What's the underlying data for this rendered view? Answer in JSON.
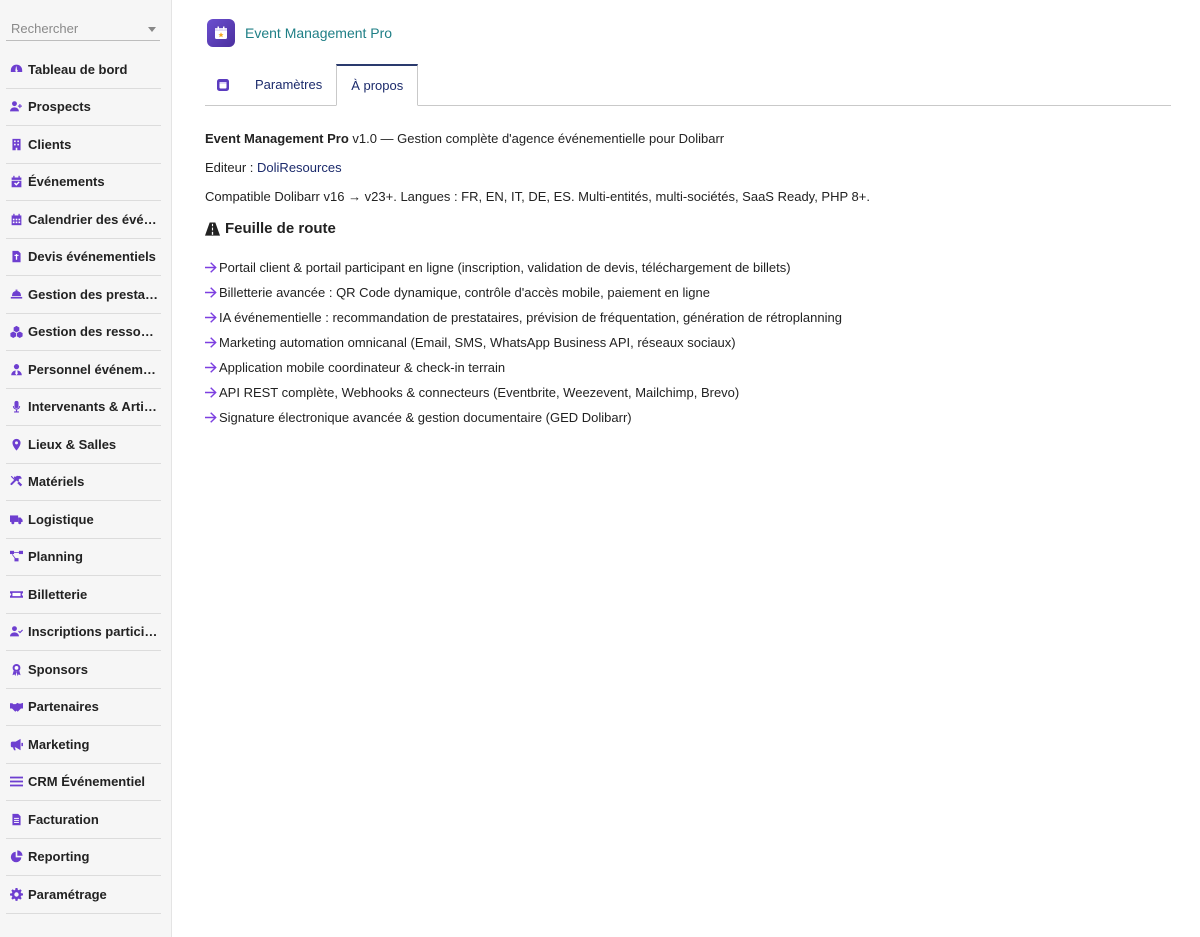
{
  "sidebar": {
    "search_placeholder": "Rechercher",
    "items": [
      {
        "label": "Tableau de bord",
        "icon": "gauge-icon"
      },
      {
        "label": "Prospects",
        "icon": "user-plus-icon"
      },
      {
        "label": "Clients",
        "icon": "building-icon"
      },
      {
        "label": "Événements",
        "icon": "calendar-check-icon"
      },
      {
        "label": "Calendrier des événements",
        "icon": "calendar-grid-icon"
      },
      {
        "label": "Devis événementiels",
        "icon": "file-invoice-icon"
      },
      {
        "label": "Gestion des prestataires",
        "icon": "concierge-bell-icon"
      },
      {
        "label": "Gestion des ressources",
        "icon": "cubes-icon"
      },
      {
        "label": "Personnel événementiel",
        "icon": "user-tie-icon"
      },
      {
        "label": "Intervenants & Artistes",
        "icon": "microphone-icon"
      },
      {
        "label": "Lieux & Salles",
        "icon": "map-marker-icon"
      },
      {
        "label": "Matériels",
        "icon": "tools-icon"
      },
      {
        "label": "Logistique",
        "icon": "truck-icon"
      },
      {
        "label": "Planning",
        "icon": "project-diagram-icon"
      },
      {
        "label": "Billetterie",
        "icon": "ticket-icon"
      },
      {
        "label": "Inscriptions participants",
        "icon": "user-check-icon"
      },
      {
        "label": "Sponsors",
        "icon": "award-icon"
      },
      {
        "label": "Partenaires",
        "icon": "handshake-icon"
      },
      {
        "label": "Marketing",
        "icon": "bullhorn-icon"
      },
      {
        "label": "CRM Événementiel",
        "icon": "bars-icon"
      },
      {
        "label": "Facturation",
        "icon": "file-text-icon"
      },
      {
        "label": "Reporting",
        "icon": "chart-pie-icon"
      },
      {
        "label": "Paramétrage",
        "icon": "gear-icon"
      }
    ]
  },
  "header": {
    "title": "Event Management Pro",
    "logo_icon": "calendar-star-icon"
  },
  "tabs": [
    {
      "label": "Paramètres",
      "active": false
    },
    {
      "label": "À propos",
      "active": true
    }
  ],
  "about": {
    "product_name": "Event Management Pro",
    "version_desc": " v1.0 — Gestion complète d'agence événementielle pour Dolibarr",
    "editor_label": "Editeur : ",
    "editor_link": "DoliResources",
    "compat": "Compatible Dolibarr v16 → v23+. Langues : FR, EN, IT, DE, ES. Multi-entités, multi-sociétés, SaaS Ready, PHP 8+."
  },
  "roadmap": {
    "title": "Feuille de route",
    "icon": "road-icon",
    "items": [
      "Portail client & portail participant en ligne (inscription, validation de devis, téléchargement de billets)",
      "Billetterie avancée : QR Code dynamique, contrôle d'accès mobile, paiement en ligne",
      "IA événementielle : recommandation de prestataires, prévision de fréquentation, génération de rétroplanning",
      "Marketing automation omnicanal (Email, SMS, WhatsApp Business API, réseaux sociaux)",
      "Application mobile coordinateur & check-in terrain",
      "API REST complète, Webhooks & connecteurs (Eventbrite, Weezevent, Mailchimp, Brevo)",
      "Signature électronique avancée & gestion documentaire (GED Dolibarr)"
    ]
  },
  "colors": {
    "accent": "#6e3fd0",
    "arrow": "#7c3fe0",
    "title_teal": "#1f7f86",
    "link_navy": "#1b2a6b"
  }
}
